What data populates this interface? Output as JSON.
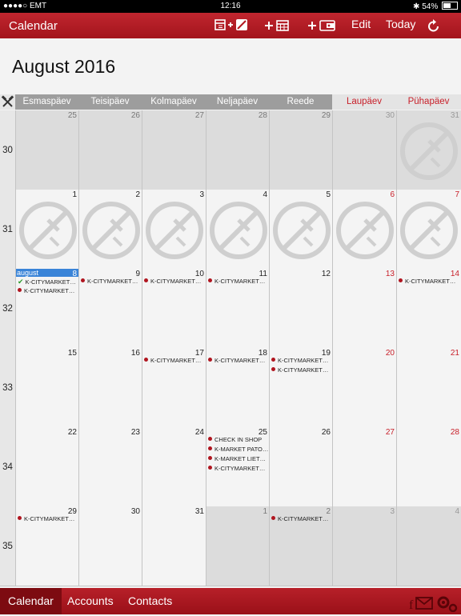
{
  "status": {
    "carrier": "●●●●○ EMT",
    "time": "12:16",
    "battery": "54%",
    "battery_level": 0.54
  },
  "nav": {
    "title": "Calendar",
    "edit": "Edit",
    "today": "Today"
  },
  "month_title": "August 2016",
  "day_names": [
    "Esmaspäev",
    "Teisipäev",
    "Kolmapäev",
    "Neljapäev",
    "Reede",
    "Laupäev",
    "Pühapäev"
  ],
  "accent": "#c0262f",
  "today_label": "august",
  "weeks": [
    {
      "num": "30",
      "days": [
        {
          "d": "25",
          "out": true,
          "events": []
        },
        {
          "d": "26",
          "out": true,
          "events": []
        },
        {
          "d": "27",
          "out": true,
          "events": []
        },
        {
          "d": "28",
          "out": true,
          "events": []
        },
        {
          "d": "29",
          "out": true,
          "events": []
        },
        {
          "d": "30",
          "out": true,
          "events": []
        },
        {
          "d": "31",
          "out": true,
          "ban": true,
          "events": []
        }
      ]
    },
    {
      "num": "31",
      "days": [
        {
          "d": "1",
          "ban": true,
          "events": []
        },
        {
          "d": "2",
          "ban": true,
          "events": []
        },
        {
          "d": "3",
          "ban": true,
          "events": []
        },
        {
          "d": "4",
          "ban": true,
          "events": []
        },
        {
          "d": "5",
          "ban": true,
          "events": []
        },
        {
          "d": "6",
          "ban": true,
          "events": []
        },
        {
          "d": "7",
          "ban": true,
          "events": []
        }
      ]
    },
    {
      "num": "32",
      "days": [
        {
          "d": "8",
          "today": true,
          "events": [
            {
              "t": "K-CITYMARKET…",
              "done": true
            },
            {
              "t": "K-CITYMARKET…"
            }
          ]
        },
        {
          "d": "9",
          "events": [
            {
              "t": "K-CITYMARKET…"
            }
          ]
        },
        {
          "d": "10",
          "events": [
            {
              "t": "K-CITYMARKET…"
            }
          ]
        },
        {
          "d": "11",
          "events": [
            {
              "t": "K-CITYMARKET…"
            }
          ]
        },
        {
          "d": "12",
          "events": []
        },
        {
          "d": "13",
          "events": []
        },
        {
          "d": "14",
          "events": [
            {
              "t": "K-CITYMARKET…"
            }
          ]
        }
      ]
    },
    {
      "num": "33",
      "days": [
        {
          "d": "15",
          "events": []
        },
        {
          "d": "16",
          "events": []
        },
        {
          "d": "17",
          "events": [
            {
              "t": "K-CITYMARKET…"
            }
          ]
        },
        {
          "d": "18",
          "events": [
            {
              "t": "K-CITYMARKET…"
            }
          ]
        },
        {
          "d": "19",
          "events": [
            {
              "t": "K-CITYMARKET…"
            },
            {
              "t": "K-CITYMARKET…"
            }
          ]
        },
        {
          "d": "20",
          "events": []
        },
        {
          "d": "21",
          "events": []
        }
      ]
    },
    {
      "num": "34",
      "days": [
        {
          "d": "22",
          "events": []
        },
        {
          "d": "23",
          "events": []
        },
        {
          "d": "24",
          "events": []
        },
        {
          "d": "25",
          "events": [
            {
              "t": "CHECK IN SHOP"
            },
            {
              "t": "K-MARKET PATO…"
            },
            {
              "t": "K-MARKET LIET…"
            },
            {
              "t": "K-CITYMARKET…"
            }
          ]
        },
        {
          "d": "26",
          "events": []
        },
        {
          "d": "27",
          "events": []
        },
        {
          "d": "28",
          "events": []
        }
      ]
    },
    {
      "num": "35",
      "days": [
        {
          "d": "29",
          "events": [
            {
              "t": "K-CITYMARKET…"
            }
          ]
        },
        {
          "d": "30",
          "events": []
        },
        {
          "d": "31",
          "events": []
        },
        {
          "d": "1",
          "out": true,
          "events": []
        },
        {
          "d": "2",
          "out": true,
          "events": [
            {
              "t": "K-CITYMARKET…"
            }
          ]
        },
        {
          "d": "3",
          "out": true,
          "events": []
        },
        {
          "d": "4",
          "out": true,
          "events": []
        }
      ]
    }
  ],
  "tabs": [
    {
      "label": "Calendar",
      "active": true
    },
    {
      "label": "Accounts"
    },
    {
      "label": "Contacts"
    }
  ]
}
